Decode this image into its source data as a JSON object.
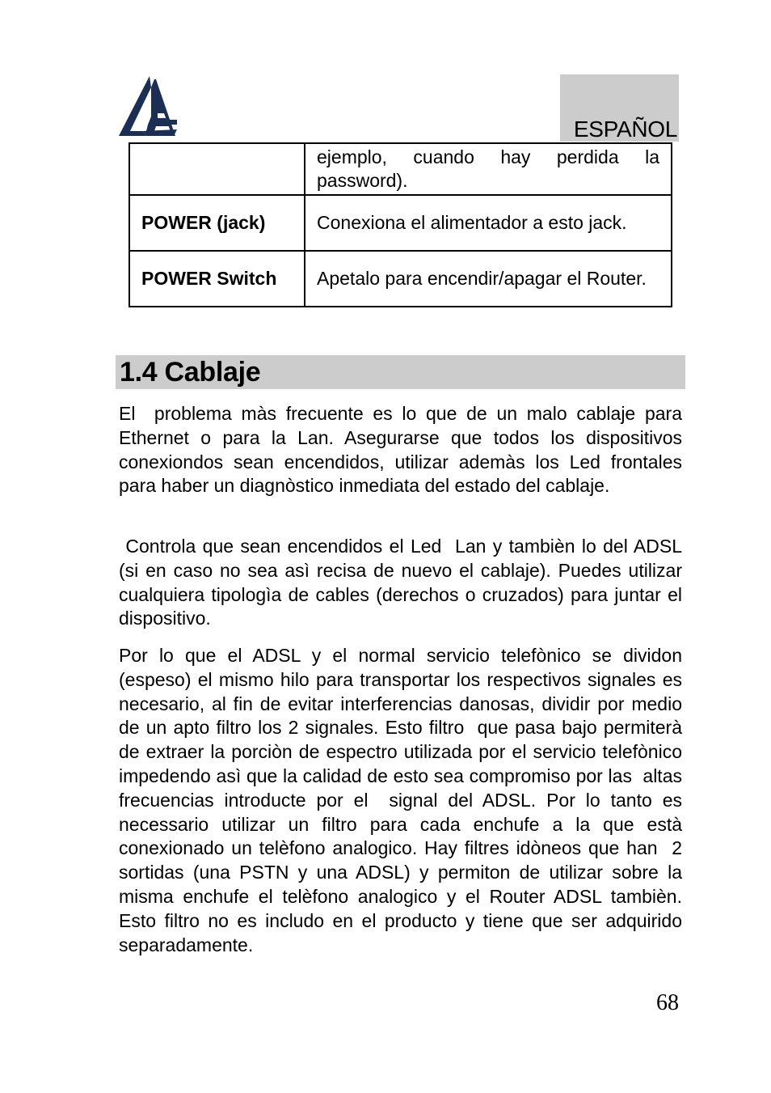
{
  "header": {
    "logo": "atlantis-land-logo-icon",
    "language_label": "ESPAÑOL",
    "colors": {
      "logo_navy": "#1b2f55",
      "header_gray": "#cccccc"
    }
  },
  "spec_table": {
    "rows": [
      {
        "key": "",
        "value": "ejemplo, cuando hay perdida la password)."
      },
      {
        "key": "POWER (jack)",
        "value": "Conexiona el alimentador a esto jack."
      },
      {
        "key": "POWER Switch",
        "value": "Apetalo para encendir/apagar el Router."
      }
    ]
  },
  "section": {
    "title": "1.4 Cablaje",
    "paragraphs": [
      "El  problema màs frecuente es lo que de un malo cablaje para Ethernet o para la Lan. Asegurarse que todos los dispositivos conexiondos sean encendidos, utilizar ademàs los Led frontales para haber un diagnòstico inmediata del estado del cablaje.",
      " Controla que sean encendidos el Led  Lan y tambièn lo del ADSL (si en caso no sea asì recisa de nuevo el cablaje). Puedes utilizar cualquiera tipologìa de cables (derechos o cruzados) para juntar el dispositivo.",
      "Por lo que el ADSL y el normal servicio telefònico se dividon (espeso) el mismo hilo para transportar los respectivos signales es necesario, al fin de evitar interferencias danosas, dividir por medio de un apto filtro los 2 signales. Esto filtro  que pasa bajo permiterà de extraer la porciòn de espectro utilizada por el servicio telefònico impedendo asì que la calidad de esto sea compromiso por las  altas frecuencias introducte por el  signal del ADSL. Por lo tanto es necessario utilizar un filtro para cada enchufe a la que està  conexionado un telèfono analogico. Hay filtres idòneos que han  2 sortidas (una PSTN y una ADSL) y permiton de utilizar sobre la misma enchufe el telèfono analogico y el Router ADSL tambièn. Esto filtro no es includo en el producto y tiene que ser adquirido separadamente."
    ]
  },
  "footer": {
    "page_number": "68"
  }
}
